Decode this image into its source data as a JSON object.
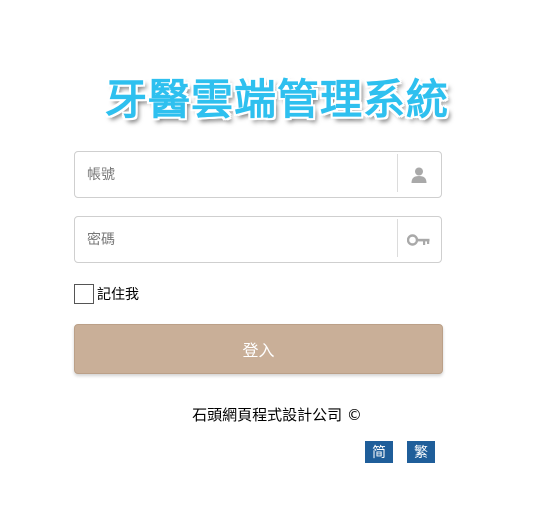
{
  "header": {
    "title": "牙醫雲端管理系統"
  },
  "login_form": {
    "username": {
      "placeholder": "帳號",
      "value": "",
      "icon": "user-icon"
    },
    "password": {
      "placeholder": "密碼",
      "value": "",
      "icon": "key-icon"
    },
    "remember_me": {
      "label": "記住我",
      "checked": false
    },
    "submit_label": "登入"
  },
  "footer": {
    "company": "石頭網頁程式設計公司 ©",
    "languages": [
      {
        "label": "简"
      },
      {
        "label": "繁"
      }
    ]
  },
  "colors": {
    "title": "#2ec0ef",
    "login_button": "#c9af98",
    "language_button": "#1f5e9a"
  }
}
